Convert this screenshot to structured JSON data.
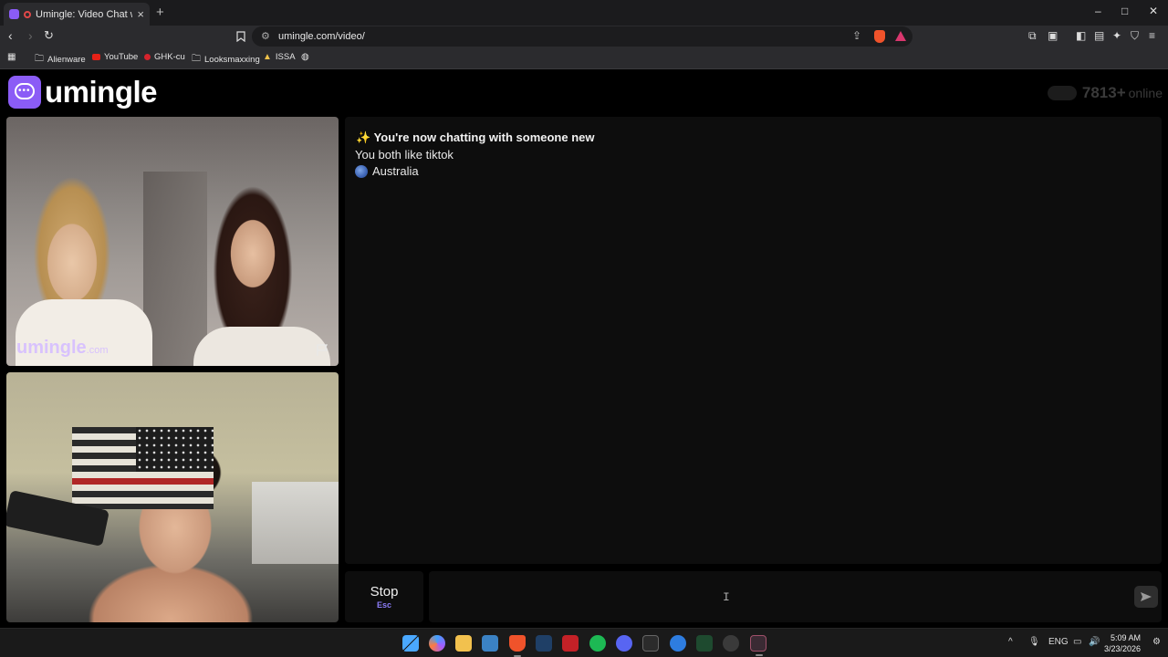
{
  "browser": {
    "tab_title": "Umingle: Video Chat with Str",
    "new_tab_label": "+",
    "url": "umingle.com/video/",
    "window_controls": {
      "minimize": "–",
      "maximize": "□",
      "close": "✕"
    }
  },
  "bookmarks": [
    {
      "label": "Alienware",
      "icon": "folder-icon"
    },
    {
      "label": "YouTube",
      "icon": "youtube-icon"
    },
    {
      "label": "GHK-cu",
      "icon": "red-dot-icon"
    },
    {
      "label": "Looksmaxxing",
      "icon": "folder-icon"
    },
    {
      "label": "ISSA",
      "icon": "issa-icon"
    }
  ],
  "site": {
    "logo_text": "umingle",
    "online_count": "7813+",
    "online_label": "online"
  },
  "remote_video": {
    "watermark_main": "umingle",
    "watermark_suffix": ".com"
  },
  "chat": {
    "system_message": "✨ You're now chatting with someone new",
    "interest_message": "You both like tiktok",
    "country": "Australia"
  },
  "controls": {
    "stop_label": "Stop",
    "stop_shortcut": "Esc",
    "message_placeholder": ""
  },
  "taskbar": {
    "language": "ENG",
    "time": "5:09 AM",
    "date": "3/23/2026"
  },
  "colors": {
    "accent": "#8b5cf6",
    "page_background": "#000000",
    "panel_background": "#0d0d0d"
  }
}
